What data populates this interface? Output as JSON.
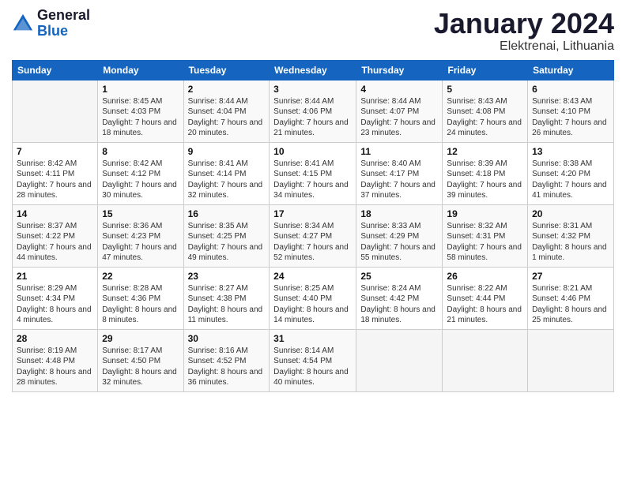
{
  "logo": {
    "general": "General",
    "blue": "Blue"
  },
  "header": {
    "month": "January 2024",
    "location": "Elektrenai, Lithuania"
  },
  "weekdays": [
    "Sunday",
    "Monday",
    "Tuesday",
    "Wednesday",
    "Thursday",
    "Friday",
    "Saturday"
  ],
  "weeks": [
    [
      {
        "day": "",
        "sunrise": "",
        "sunset": "",
        "daylight": ""
      },
      {
        "day": "1",
        "sunrise": "Sunrise: 8:45 AM",
        "sunset": "Sunset: 4:03 PM",
        "daylight": "Daylight: 7 hours and 18 minutes."
      },
      {
        "day": "2",
        "sunrise": "Sunrise: 8:44 AM",
        "sunset": "Sunset: 4:04 PM",
        "daylight": "Daylight: 7 hours and 20 minutes."
      },
      {
        "day": "3",
        "sunrise": "Sunrise: 8:44 AM",
        "sunset": "Sunset: 4:06 PM",
        "daylight": "Daylight: 7 hours and 21 minutes."
      },
      {
        "day": "4",
        "sunrise": "Sunrise: 8:44 AM",
        "sunset": "Sunset: 4:07 PM",
        "daylight": "Daylight: 7 hours and 23 minutes."
      },
      {
        "day": "5",
        "sunrise": "Sunrise: 8:43 AM",
        "sunset": "Sunset: 4:08 PM",
        "daylight": "Daylight: 7 hours and 24 minutes."
      },
      {
        "day": "6",
        "sunrise": "Sunrise: 8:43 AM",
        "sunset": "Sunset: 4:10 PM",
        "daylight": "Daylight: 7 hours and 26 minutes."
      }
    ],
    [
      {
        "day": "7",
        "sunrise": "Sunrise: 8:42 AM",
        "sunset": "Sunset: 4:11 PM",
        "daylight": "Daylight: 7 hours and 28 minutes."
      },
      {
        "day": "8",
        "sunrise": "Sunrise: 8:42 AM",
        "sunset": "Sunset: 4:12 PM",
        "daylight": "Daylight: 7 hours and 30 minutes."
      },
      {
        "day": "9",
        "sunrise": "Sunrise: 8:41 AM",
        "sunset": "Sunset: 4:14 PM",
        "daylight": "Daylight: 7 hours and 32 minutes."
      },
      {
        "day": "10",
        "sunrise": "Sunrise: 8:41 AM",
        "sunset": "Sunset: 4:15 PM",
        "daylight": "Daylight: 7 hours and 34 minutes."
      },
      {
        "day": "11",
        "sunrise": "Sunrise: 8:40 AM",
        "sunset": "Sunset: 4:17 PM",
        "daylight": "Daylight: 7 hours and 37 minutes."
      },
      {
        "day": "12",
        "sunrise": "Sunrise: 8:39 AM",
        "sunset": "Sunset: 4:18 PM",
        "daylight": "Daylight: 7 hours and 39 minutes."
      },
      {
        "day": "13",
        "sunrise": "Sunrise: 8:38 AM",
        "sunset": "Sunset: 4:20 PM",
        "daylight": "Daylight: 7 hours and 41 minutes."
      }
    ],
    [
      {
        "day": "14",
        "sunrise": "Sunrise: 8:37 AM",
        "sunset": "Sunset: 4:22 PM",
        "daylight": "Daylight: 7 hours and 44 minutes."
      },
      {
        "day": "15",
        "sunrise": "Sunrise: 8:36 AM",
        "sunset": "Sunset: 4:23 PM",
        "daylight": "Daylight: 7 hours and 47 minutes."
      },
      {
        "day": "16",
        "sunrise": "Sunrise: 8:35 AM",
        "sunset": "Sunset: 4:25 PM",
        "daylight": "Daylight: 7 hours and 49 minutes."
      },
      {
        "day": "17",
        "sunrise": "Sunrise: 8:34 AM",
        "sunset": "Sunset: 4:27 PM",
        "daylight": "Daylight: 7 hours and 52 minutes."
      },
      {
        "day": "18",
        "sunrise": "Sunrise: 8:33 AM",
        "sunset": "Sunset: 4:29 PM",
        "daylight": "Daylight: 7 hours and 55 minutes."
      },
      {
        "day": "19",
        "sunrise": "Sunrise: 8:32 AM",
        "sunset": "Sunset: 4:31 PM",
        "daylight": "Daylight: 7 hours and 58 minutes."
      },
      {
        "day": "20",
        "sunrise": "Sunrise: 8:31 AM",
        "sunset": "Sunset: 4:32 PM",
        "daylight": "Daylight: 8 hours and 1 minute."
      }
    ],
    [
      {
        "day": "21",
        "sunrise": "Sunrise: 8:29 AM",
        "sunset": "Sunset: 4:34 PM",
        "daylight": "Daylight: 8 hours and 4 minutes."
      },
      {
        "day": "22",
        "sunrise": "Sunrise: 8:28 AM",
        "sunset": "Sunset: 4:36 PM",
        "daylight": "Daylight: 8 hours and 8 minutes."
      },
      {
        "day": "23",
        "sunrise": "Sunrise: 8:27 AM",
        "sunset": "Sunset: 4:38 PM",
        "daylight": "Daylight: 8 hours and 11 minutes."
      },
      {
        "day": "24",
        "sunrise": "Sunrise: 8:25 AM",
        "sunset": "Sunset: 4:40 PM",
        "daylight": "Daylight: 8 hours and 14 minutes."
      },
      {
        "day": "25",
        "sunrise": "Sunrise: 8:24 AM",
        "sunset": "Sunset: 4:42 PM",
        "daylight": "Daylight: 8 hours and 18 minutes."
      },
      {
        "day": "26",
        "sunrise": "Sunrise: 8:22 AM",
        "sunset": "Sunset: 4:44 PM",
        "daylight": "Daylight: 8 hours and 21 minutes."
      },
      {
        "day": "27",
        "sunrise": "Sunrise: 8:21 AM",
        "sunset": "Sunset: 4:46 PM",
        "daylight": "Daylight: 8 hours and 25 minutes."
      }
    ],
    [
      {
        "day": "28",
        "sunrise": "Sunrise: 8:19 AM",
        "sunset": "Sunset: 4:48 PM",
        "daylight": "Daylight: 8 hours and 28 minutes."
      },
      {
        "day": "29",
        "sunrise": "Sunrise: 8:17 AM",
        "sunset": "Sunset: 4:50 PM",
        "daylight": "Daylight: 8 hours and 32 minutes."
      },
      {
        "day": "30",
        "sunrise": "Sunrise: 8:16 AM",
        "sunset": "Sunset: 4:52 PM",
        "daylight": "Daylight: 8 hours and 36 minutes."
      },
      {
        "day": "31",
        "sunrise": "Sunrise: 8:14 AM",
        "sunset": "Sunset: 4:54 PM",
        "daylight": "Daylight: 8 hours and 40 minutes."
      },
      {
        "day": "",
        "sunrise": "",
        "sunset": "",
        "daylight": ""
      },
      {
        "day": "",
        "sunrise": "",
        "sunset": "",
        "daylight": ""
      },
      {
        "day": "",
        "sunrise": "",
        "sunset": "",
        "daylight": ""
      }
    ]
  ]
}
